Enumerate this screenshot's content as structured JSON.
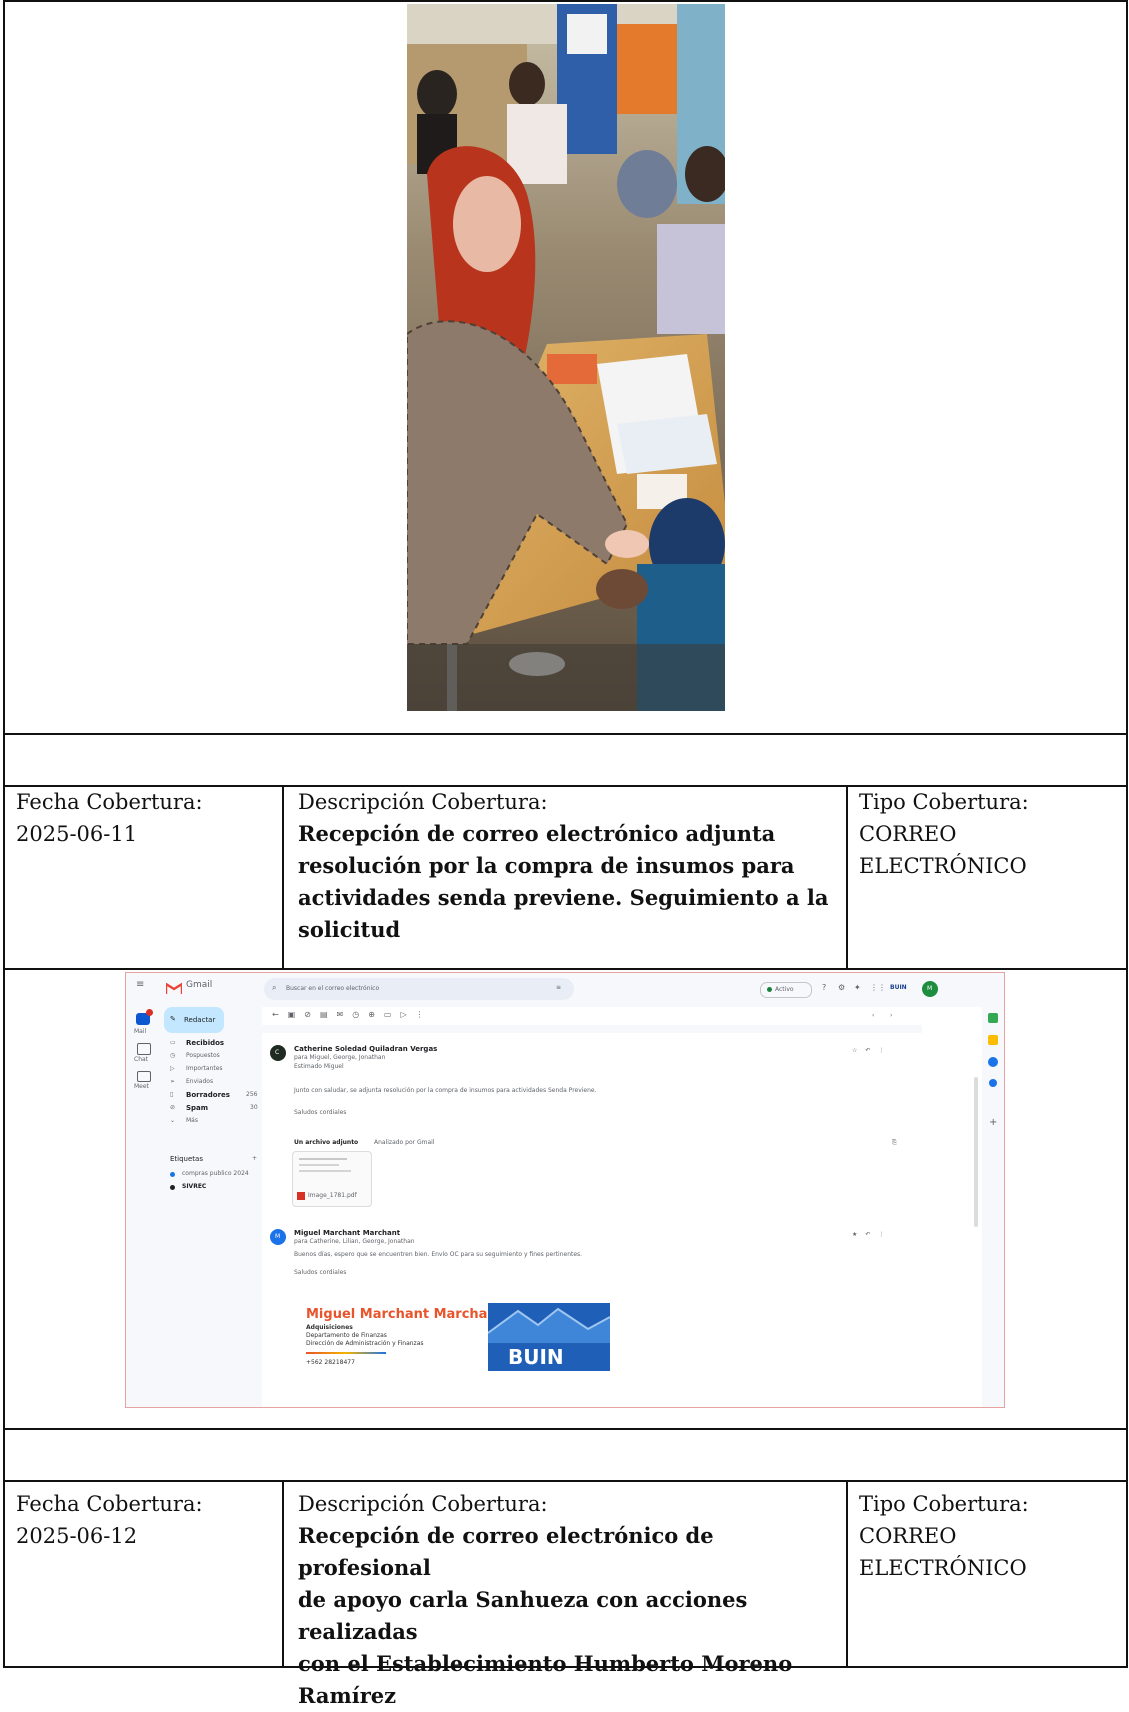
{
  "rows": [
    {
      "fecha_label": "Fecha Cobertura:",
      "fecha": "2025-06-11",
      "descripcion_label": "Descripción Cobertura:",
      "descripcion_lines": [
        "Recepción de correo electrónico adjunta",
        "resolución por la compra de insumos para",
        "actividades senda previene. Seguimiento a la",
        "solicitud"
      ],
      "tipo_label": "Tipo Cobertura:",
      "tipo_lines": [
        "CORREO",
        "ELECTRÓNICO"
      ]
    },
    {
      "fecha_label": "Fecha Cobertura:",
      "fecha": "2025-06-12",
      "descripcion_label": "Descripción Cobertura:",
      "descripcion_lines": [
        "Recepción de correo electrónico de profesional",
        "de apoyo carla Sanhueza con acciones realizadas",
        "con el Establecimiento Humberto Moreno",
        "Ramírez"
      ],
      "tipo_label": "Tipo Cobertura:",
      "tipo_lines": [
        "CORREO",
        "ELECTRÓNICO"
      ]
    }
  ],
  "gmail": {
    "app_name": "Gmail",
    "search_placeholder": "Buscar en el correo electrónico",
    "status": "Activo",
    "account_label": "BUIN",
    "avatar_letter": "M",
    "compose": "Redactar",
    "nav": [
      {
        "label": "Recibidos",
        "count": ""
      },
      {
        "label": "Pospuestos",
        "count": ""
      },
      {
        "label": "Importantes",
        "count": ""
      },
      {
        "label": "Enviados",
        "count": ""
      },
      {
        "label": "Borradores",
        "count": "256"
      },
      {
        "label": "Spam",
        "count": "30"
      },
      {
        "label": "Más",
        "count": ""
      }
    ],
    "labels_header": "Etiquetas",
    "labels": [
      {
        "label": "compras publico 2024",
        "color": "#1a73e8"
      },
      {
        "label": "SIVREC",
        "color": "#202124"
      }
    ],
    "rail": [
      "Mail",
      "Chat",
      "Meet"
    ],
    "messages": [
      {
        "avatar": "C",
        "sender": "Catherine Soledad Quiladran Vergas",
        "to": "para Miguel, George, Jonathan",
        "greeting": "Estimado Miguel",
        "body": "Junto con saludar, se adjunta resolución por la compra de insumos para actividades Senda Previene.",
        "closing": "Saludos cordiales",
        "attachment_header": "Un archivo adjunto",
        "attachment_note": "Analizado por Gmail",
        "attachment_name": "Image_1781.pdf"
      },
      {
        "avatar": "M",
        "sender": "Miguel Marchant Marchant",
        "to": "para Catherine, Lilian, George, Jonathan",
        "body": "Buenos días, espero que se encuentren bien. Envío OC para su seguimiento y fines pertinentes.",
        "closing": "Saludos cordiales"
      }
    ],
    "signature": {
      "name": "Miguel Marchant Marchant",
      "role": "Adquisiciones",
      "dept": "Departamento de Finanzas",
      "direction": "Dirección de Administración y Finanzas",
      "phone": "+562 28218477",
      "logo": "BUIN"
    }
  }
}
